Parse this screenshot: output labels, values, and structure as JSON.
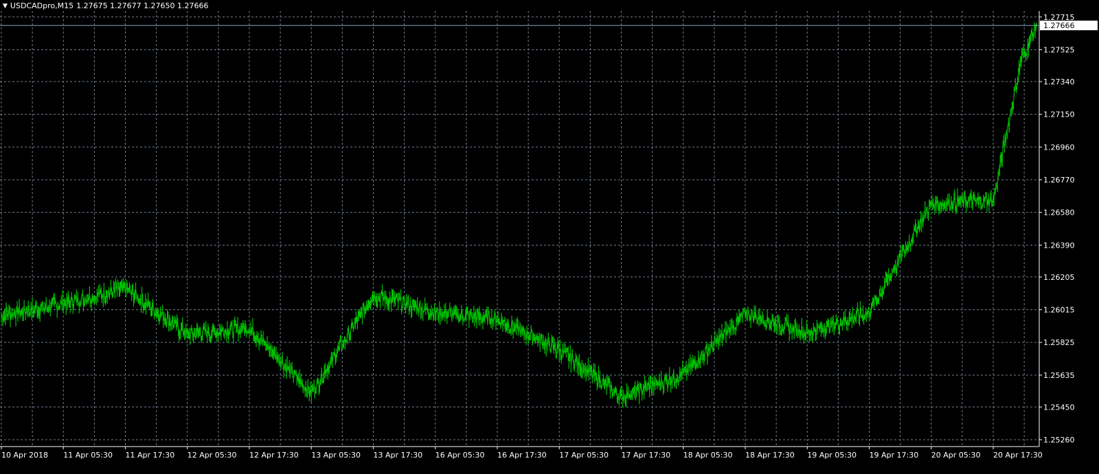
{
  "header": {
    "menu_icon": "triangle-down-icon",
    "symbol_timeframe": "USDCADpro,M15",
    "ohlc": "1.27675 1.27677 1.27650 1.27666"
  },
  "colors": {
    "background": "#000000",
    "grid": "#708090",
    "axis": "#ffffff",
    "bars": "#00c000",
    "price_line": "#8ea9c4",
    "price_label_bg": "#ffffff",
    "price_label_text": "#000000"
  },
  "chart_data": {
    "type": "line",
    "title": "USDCADpro,M15",
    "grid": true,
    "current_price_label": "1.27666",
    "current_price": 1.27666,
    "y_ticks": [
      "1.27715",
      "1.27525",
      "1.27340",
      "1.27150",
      "1.26960",
      "1.26770",
      "1.26580",
      "1.26390",
      "1.26205",
      "1.26015",
      "1.25825",
      "1.25635",
      "1.25450",
      "1.25260"
    ],
    "ylim": [
      1.2522,
      1.2775
    ],
    "x_labels": [
      "10 Apr 2018",
      "11 Apr 05:30",
      "11 Apr 17:30",
      "12 Apr 05:30",
      "12 Apr 17:30",
      "13 Apr 05:30",
      "13 Apr 17:30",
      "16 Apr 05:30",
      "16 Apr 17:30",
      "17 Apr 05:30",
      "17 Apr 17:30",
      "18 Apr 05:30",
      "18 Apr 17:30",
      "19 Apr 05:30",
      "19 Apr 17:30",
      "20 Apr 05:30",
      "20 Apr 17:30"
    ],
    "series": [
      {
        "x": [
          0,
          1,
          2,
          3,
          4,
          5,
          6,
          7,
          8,
          9,
          10,
          11,
          12,
          13,
          14,
          15,
          16,
          16.45,
          16.7
        ],
        "values": [
          1.2598,
          1.2605,
          1.2614,
          1.2587,
          1.2591,
          1.2553,
          1.261,
          1.26,
          1.2596,
          1.2578,
          1.2551,
          1.2564,
          1.2599,
          1.2588,
          1.26,
          1.2663,
          1.2665,
          1.2746,
          1.2767
        ]
      }
    ]
  }
}
